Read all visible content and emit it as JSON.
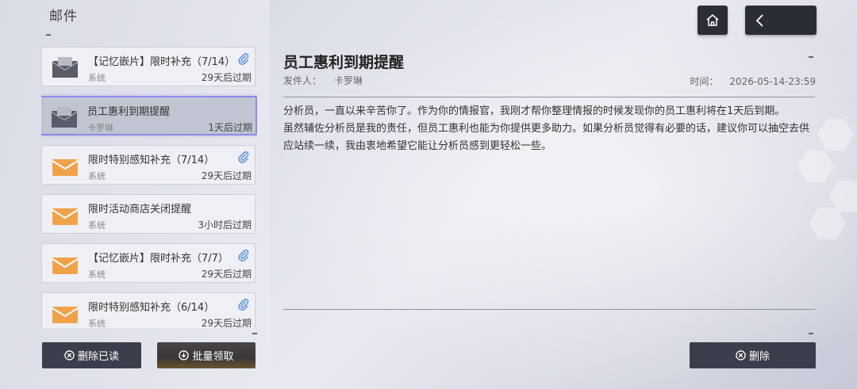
{
  "header": {
    "title": "邮件"
  },
  "mails": [
    {
      "title": "【记忆嵌片】限时补充（7/14）",
      "sender": "系统",
      "expire": "29天后过期",
      "type": "gray",
      "attachment": true,
      "selected": false
    },
    {
      "title": "员工惠利到期提醒",
      "sender": "卡罗琳",
      "expire": "1天后过期",
      "type": "gray",
      "attachment": false,
      "selected": true
    },
    {
      "title": "限时特别感知补充（7/14）",
      "sender": "系统",
      "expire": "29天后过期",
      "type": "orange",
      "attachment": true,
      "selected": false
    },
    {
      "title": "限时活动商店关闭提醒",
      "sender": "系统",
      "expire": "3小时后过期",
      "type": "orange",
      "attachment": false,
      "selected": false
    },
    {
      "title": "【记忆嵌片】限时补充（7/7）",
      "sender": "系统",
      "expire": "29天后过期",
      "type": "orange",
      "attachment": true,
      "selected": false
    },
    {
      "title": "限时特别感知补充（6/14）",
      "sender": "系统",
      "expire": "29天后过期",
      "type": "orange",
      "attachment": true,
      "selected": false
    }
  ],
  "buttons": {
    "delete_read": "删除已读",
    "batch_claim": "批量领取",
    "delete": "删除"
  },
  "detail": {
    "title": "员工惠利到期提醒",
    "sender_label": "发件人：",
    "sender": "卡罗琳",
    "time_label": "时间：",
    "time": "2026-05-14-23:59",
    "paragraphs": [
      "分析员，一直以来辛苦你了。作为你的情报官，我刚才帮你整理情报的时候发现你的员工惠利将在1天后到期。",
      "虽然辅佐分析员是我的责任，但员工惠利也能为你提供更多助力。如果分析员觉得有必要的话，建议你可以抽空去供应站续一续，我由衷地希望它能让分析员感到更轻松一些。"
    ]
  },
  "icons": {
    "home": "home-icon",
    "back": "back-arrow-icon",
    "attachment": "paperclip-icon",
    "delete": "circle-x-icon",
    "claim": "circle-download-icon"
  },
  "colors": {
    "accent_select": "#8c8ce8",
    "mail_orange": "#f0a24a",
    "mail_gray": "#5a5d69",
    "button_dark": "#3b3e4b",
    "attach_blue": "#5b8fd9"
  }
}
